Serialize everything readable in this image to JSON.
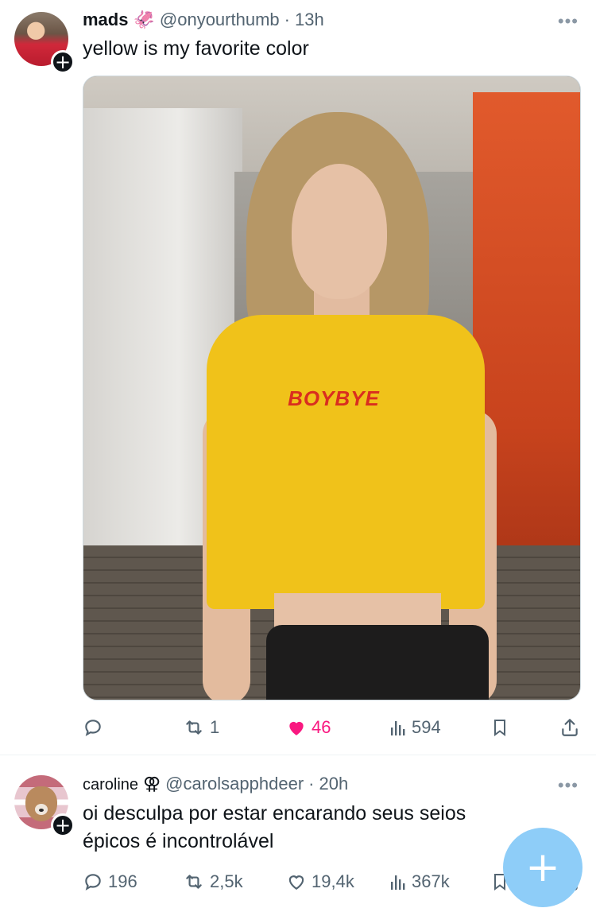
{
  "tweets": [
    {
      "author_name": "mads",
      "author_emoji": "🦑",
      "handle": "@onyourthumb",
      "separator": "·",
      "time": "13h",
      "text": "yellow is my favorite color",
      "media_shirt_text": "BOYBYE",
      "replies": "",
      "reposts": "1",
      "likes": "46",
      "views": "594",
      "liked": true
    },
    {
      "author_name": "caroline",
      "author_emoji": "⚢",
      "handle": "@carolsapphdeer",
      "separator": "·",
      "time": "20h",
      "text": "oi desculpa por estar encarando seus seios épicos é incontrolável",
      "replies": "196",
      "reposts": "2,5k",
      "likes": "19,4k",
      "views": "367k",
      "liked": false
    }
  ],
  "more_icon_glyph": "•••",
  "follow_glyph": "+",
  "compose_glyph": "+",
  "colors": {
    "like": "#f91880",
    "muted": "#536471",
    "fab": "#8ecdf8"
  },
  "icons": [
    "reply-icon",
    "repost-icon",
    "like-icon",
    "views-icon",
    "bookmark-icon",
    "share-icon",
    "compose-icon"
  ]
}
